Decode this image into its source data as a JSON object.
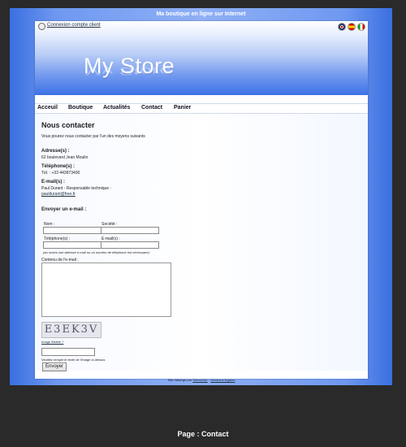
{
  "site": {
    "title": "Ma boutique en ligne sur Internet",
    "login_link": "Connexion compte client",
    "logo": "My Store",
    "flags": [
      "uk-flag",
      "spain-flag",
      "italy-flag"
    ]
  },
  "nav": {
    "items": [
      "Acceuil",
      "Boutique",
      "Actualités",
      "Contact",
      "Panier"
    ]
  },
  "contact": {
    "heading": "Nous contacter",
    "intro": "Vous pourez nous contacter par l'un des moyens suivants",
    "address_label": "Adresse(s) :",
    "address_value": "62 boulevard Jean Moulin",
    "phone_label": "Téléphone(s) :",
    "phone_value": "Tél. : +33 443873490",
    "email_label": "E-mail(s) :",
    "email_person": "Paul Durant - Responsable technique :",
    "email_link": "pauldurant@free.fr"
  },
  "form": {
    "heading": "Envoyer un e-mail :",
    "name_label": "Nom :",
    "company_label": "Société :",
    "phone_label": "Téléphone(s) :",
    "email_label": "E-mail(s) :",
    "hint": "(au moins une adresse e-mail ou un numéro de téléphone est nécessaire)",
    "message_label": "Contenu de l'e-mail :",
    "captcha_text": "E3EK3V",
    "captcha_help": "Image illisible ?",
    "captcha_instruction": "Veuillez remplir le texte de l'image ci-dessus",
    "submit_label": "Envoyer"
  },
  "footer": {
    "text": "Site hébergé par",
    "link1": "WebsaVer",
    "sep": " - ",
    "link2": "Mentions légales"
  },
  "caption": "Page : Contact"
}
